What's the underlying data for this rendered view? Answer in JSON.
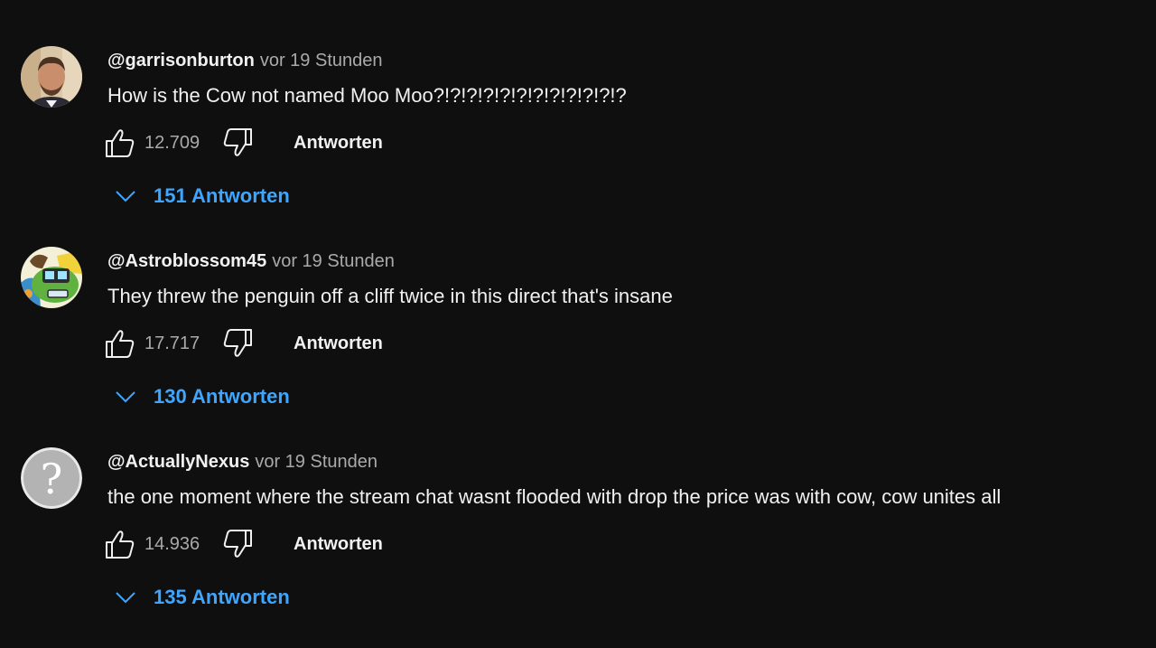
{
  "comments": [
    {
      "author": "@garrisonburton",
      "time": "vor 19 Stunden",
      "text": "How is the Cow not named Moo Moo?!?!?!?!?!?!?!?!?!?!?!?",
      "likes": "12.709",
      "reply_label": "Antworten",
      "replies_label": "151 Antworten",
      "avatar_icon": "person-photo-avatar"
    },
    {
      "author": "@Astroblossom45",
      "time": "vor 19 Stunden",
      "text": "They threw the penguin off a cliff twice in this direct that's insane",
      "likes": "17.717",
      "reply_label": "Antworten",
      "replies_label": "130 Antworten",
      "avatar_icon": "cartoon-frog-avatar"
    },
    {
      "author": "@ActuallyNexus",
      "time": "vor 19 Stunden",
      "text": "the one moment where the stream chat wasnt flooded with drop the price was with cow, cow unites all",
      "likes": "14.936",
      "reply_label": "Antworten",
      "replies_label": "135 Antworten",
      "avatar_icon": "question-mark-avatar"
    }
  ],
  "colors": {
    "background": "#0f0f0f",
    "text": "#f1f1f1",
    "secondary": "#aaaaaa",
    "link": "#3ea6ff"
  }
}
